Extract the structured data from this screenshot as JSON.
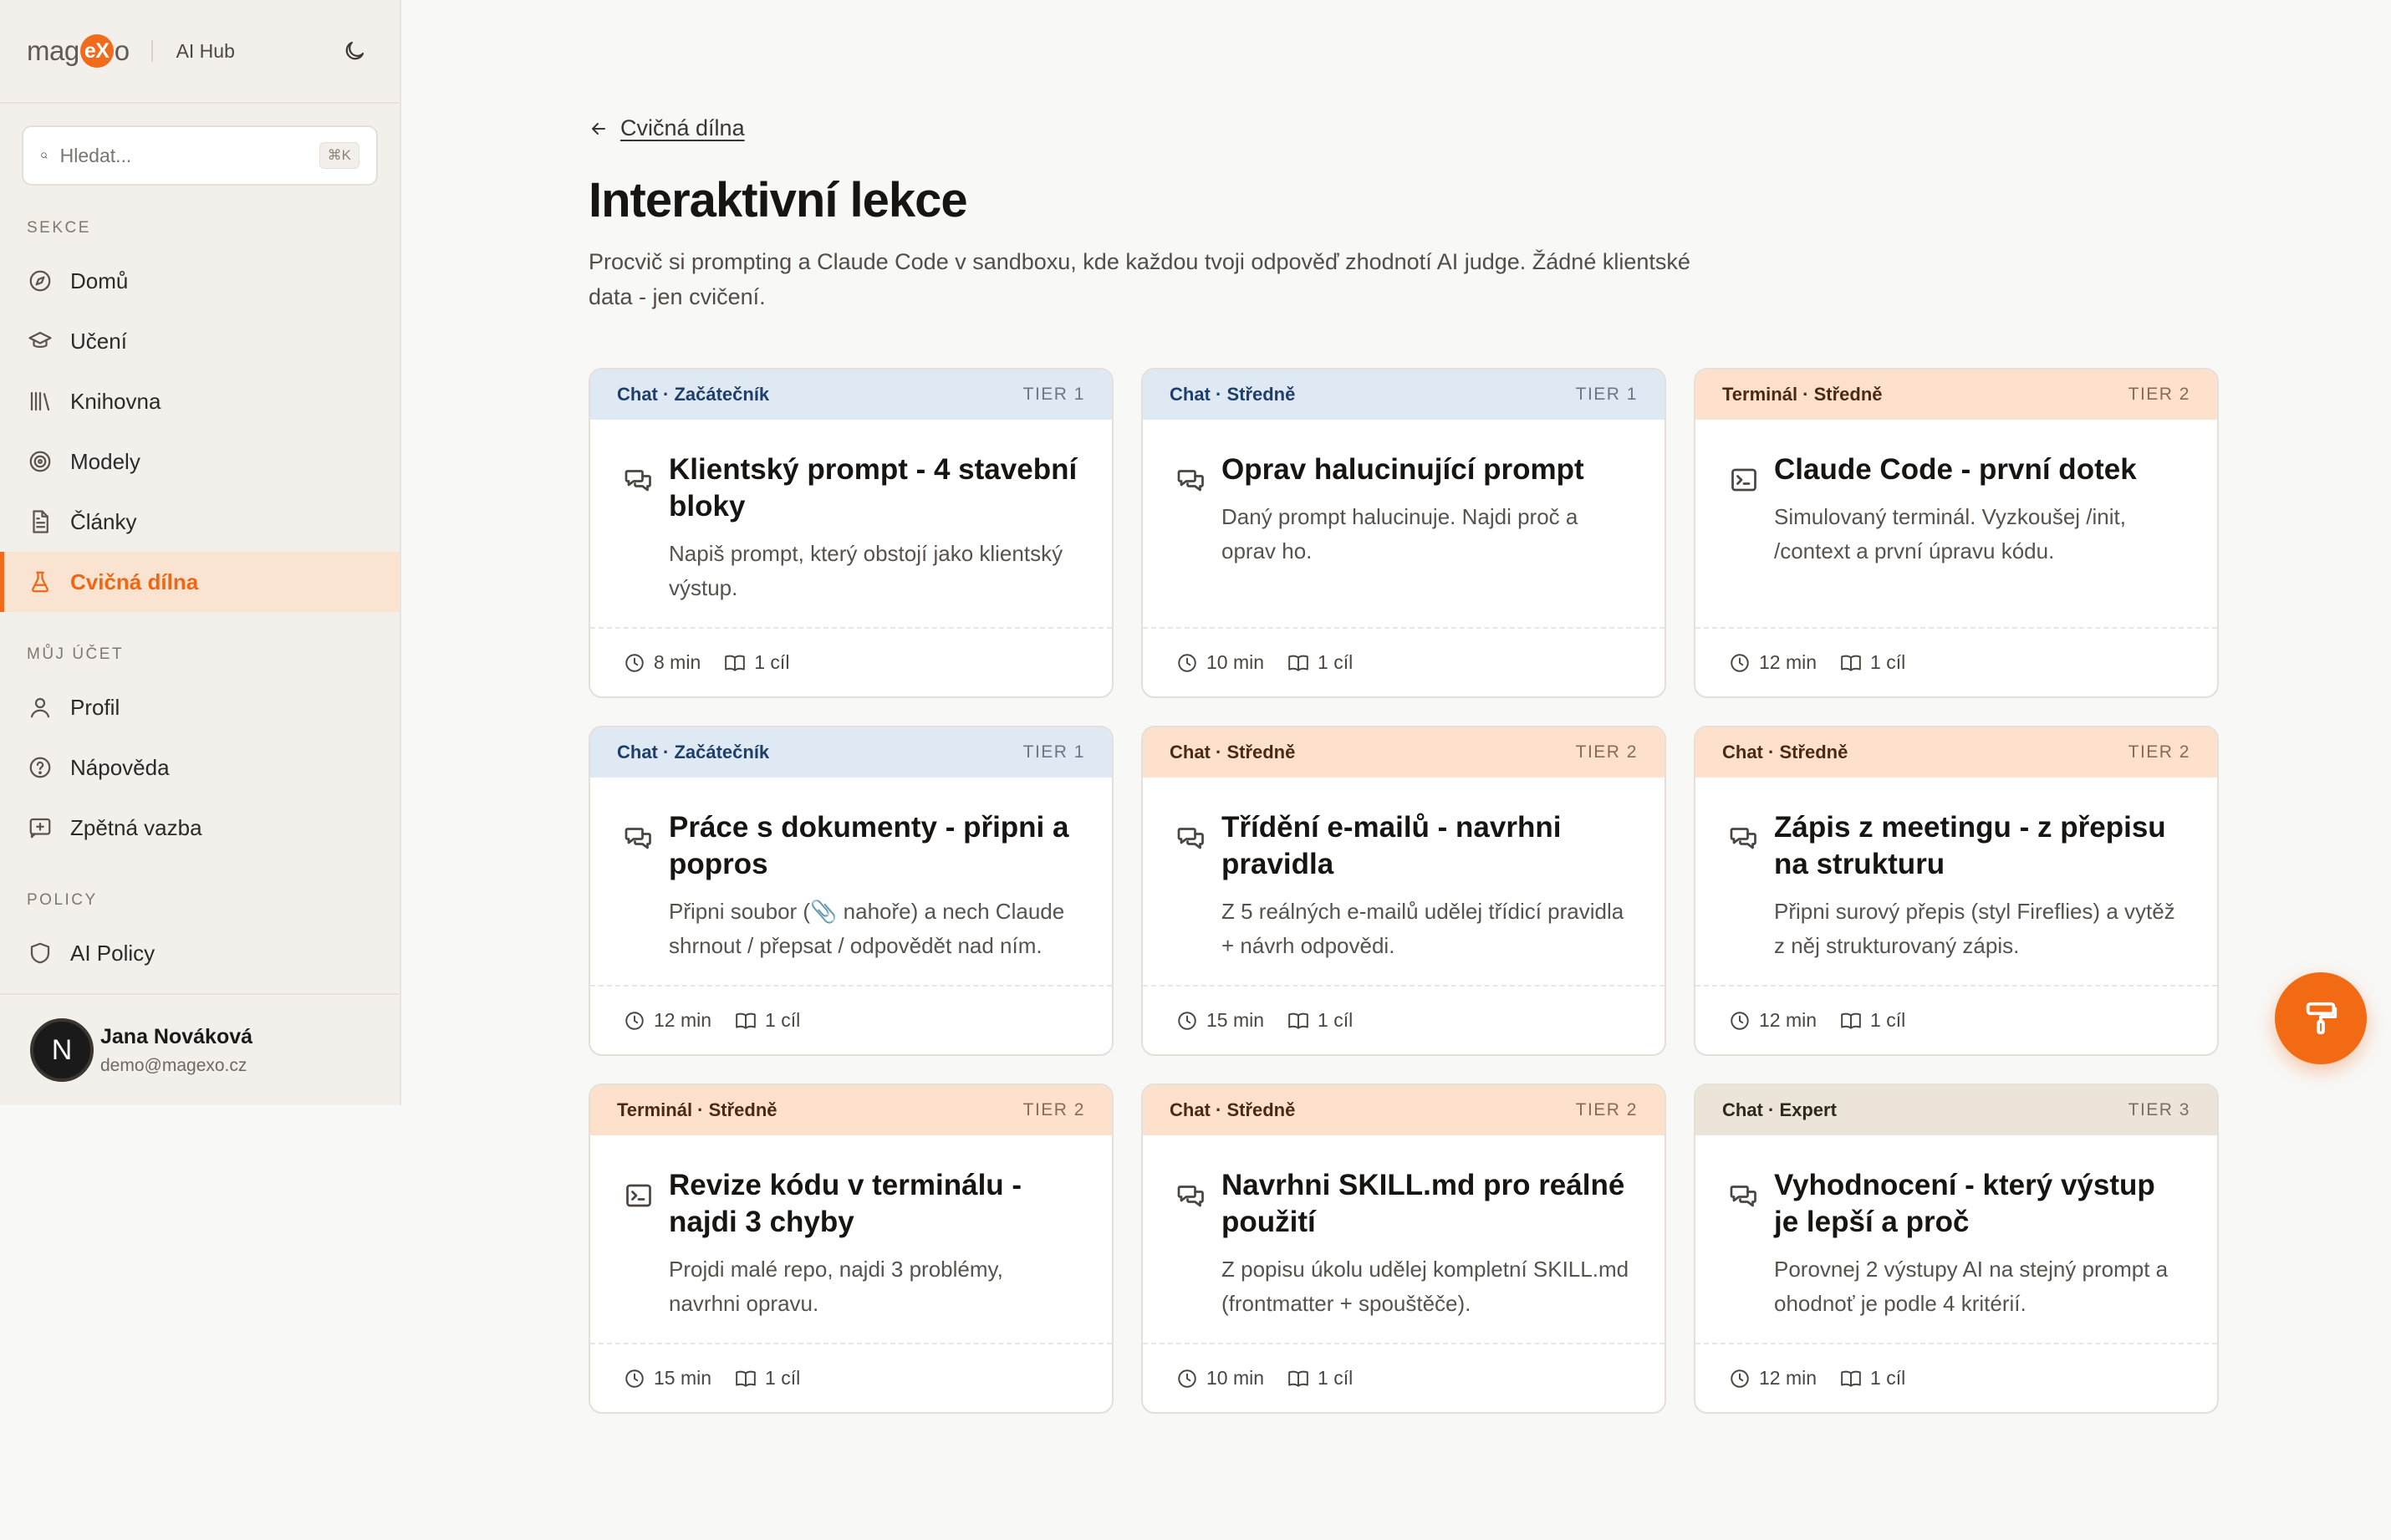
{
  "brand": {
    "logo_pre": "mag",
    "logo_mid": "eX",
    "logo_post": "o",
    "app_name": "AI Hub",
    "accent": "#f26a1b"
  },
  "search": {
    "placeholder": "Hledat...",
    "shortcut": "⌘K"
  },
  "sidebar": {
    "sections": [
      {
        "title": "SEKCE",
        "items": [
          {
            "label": "Domů",
            "icon": "compass-icon"
          },
          {
            "label": "Učení",
            "icon": "graduation-cap-icon"
          },
          {
            "label": "Knihovna",
            "icon": "library-icon"
          },
          {
            "label": "Modely",
            "icon": "target-icon"
          },
          {
            "label": "Články",
            "icon": "document-icon"
          },
          {
            "label": "Cvičná dílna",
            "icon": "flask-icon",
            "active": true
          }
        ]
      },
      {
        "title": "MŮJ ÚČET",
        "items": [
          {
            "label": "Profil",
            "icon": "user-icon"
          },
          {
            "label": "Nápověda",
            "icon": "help-circle-icon"
          },
          {
            "label": "Zpětná vazba",
            "icon": "feedback-icon"
          }
        ]
      },
      {
        "title": "POLICY",
        "items": [
          {
            "label": "AI Policy",
            "icon": "shield-icon"
          }
        ]
      }
    ]
  },
  "user": {
    "initial": "N",
    "name": "Jana Nováková",
    "email": "demo@magexo.cz"
  },
  "main": {
    "back_label": "Cvičná dílna",
    "title": "Interaktivní lekce",
    "description": "Procvič si prompting a Claude Code v sandboxu, kde každou tvoji odpověď zhodnotí AI judge. Žádné klientské data - jen cvičení."
  },
  "lessons": [
    {
      "tag": "Chat · Začátečník",
      "tier": "TIER 1",
      "color": "blue",
      "icon": "chat-icon",
      "title": "Klientský prompt - 4 stavební bloky",
      "desc": "Napiš prompt, který obstojí jako klientský výstup.",
      "duration": "8 min",
      "goals": "1 cíl"
    },
    {
      "tag": "Chat · Středně",
      "tier": "TIER 1",
      "color": "blue",
      "icon": "chat-icon",
      "title": "Oprav halucinující prompt",
      "desc": "Daný prompt halucinuje. Najdi proč a oprav ho.",
      "duration": "10 min",
      "goals": "1 cíl"
    },
    {
      "tag": "Terminál · Středně",
      "tier": "TIER 2",
      "color": "orange",
      "icon": "terminal-icon",
      "title": "Claude Code - první dotek",
      "desc": "Simulovaný terminál. Vyzkoušej /init, /context a první úpravu kódu.",
      "duration": "12 min",
      "goals": "1 cíl"
    },
    {
      "tag": "Chat · Začátečník",
      "tier": "TIER 1",
      "color": "blue",
      "icon": "chat-icon",
      "title": "Práce s dokumenty - připni a popros",
      "desc": "Připni soubor (📎 nahoře) a nech Claude shrnout / přepsat / odpovědět nad ním.",
      "duration": "12 min",
      "goals": "1 cíl"
    },
    {
      "tag": "Chat · Středně",
      "tier": "TIER 2",
      "color": "orange",
      "icon": "chat-icon",
      "title": "Třídění e-mailů - navrhni pravidla",
      "desc": "Z 5 reálných e-mailů udělej třídicí pravidla + návrh odpovědi.",
      "duration": "15 min",
      "goals": "1 cíl"
    },
    {
      "tag": "Chat · Středně",
      "tier": "TIER 2",
      "color": "orange",
      "icon": "chat-icon",
      "title": "Zápis z meetingu - z přepisu na strukturu",
      "desc": "Připni surový přepis (styl Fireflies) a vytěž z něj strukturovaný zápis.",
      "duration": "12 min",
      "goals": "1 cíl"
    },
    {
      "tag": "Terminál · Středně",
      "tier": "TIER 2",
      "color": "orange",
      "icon": "terminal-icon",
      "title": "Revize kódu v terminálu - najdi 3 chyby",
      "desc": "Projdi malé repo, najdi 3 problémy, navrhni opravu.",
      "duration": "15 min",
      "goals": "1 cíl"
    },
    {
      "tag": "Chat · Středně",
      "tier": "TIER 2",
      "color": "orange",
      "icon": "chat-icon",
      "title": "Navrhni SKILL.md pro reálné použití",
      "desc": "Z popisu úkolu udělej kompletní SKILL.md (frontmatter + spouštěče).",
      "duration": "10 min",
      "goals": "1 cíl"
    },
    {
      "tag": "Chat · Expert",
      "tier": "TIER 3",
      "color": "beige",
      "icon": "chat-icon",
      "title": "Vyhodnocení - který výstup je lepší a proč",
      "desc": "Porovnej 2 výstupy AI na stejný prompt a ohodnoť je podle 4 kritérií.",
      "duration": "12 min",
      "goals": "1 cíl"
    }
  ],
  "fab": {
    "icon": "paint-roller-icon"
  }
}
